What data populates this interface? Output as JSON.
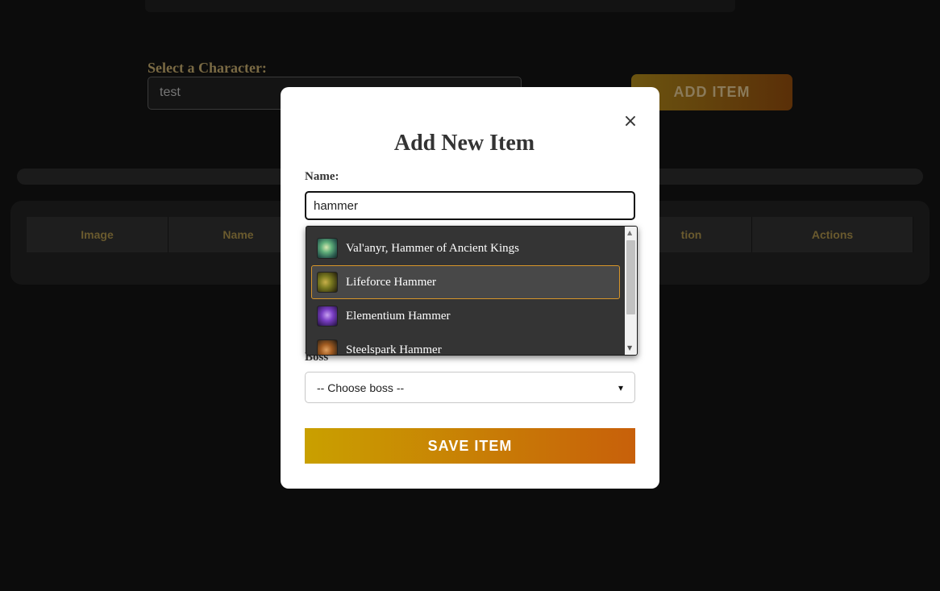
{
  "background": {
    "character_label": "Select a Character:",
    "character_value": "test",
    "add_item_label": "ADD ITEM",
    "table_headers": [
      "Image",
      "Name",
      "",
      "",
      "tion",
      "Actions"
    ]
  },
  "modal": {
    "title": "Add New Item",
    "name_label": "Name:",
    "name_value": "hammer",
    "boss_label": "Boss",
    "boss_selected": "-- Choose boss --",
    "save_label": "SAVE ITEM",
    "close_glyph": "×"
  },
  "dropdown": {
    "items": [
      {
        "label": "Val'anyr, Hammer of Ancient Kings",
        "icon": "valanyr-hammer-icon",
        "selected": false
      },
      {
        "label": "Lifeforce Hammer",
        "icon": "lifeforce-hammer-icon",
        "selected": true
      },
      {
        "label": "Elementium Hammer",
        "icon": "elementium-hammer-icon",
        "selected": false
      },
      {
        "label": "Steelspark Hammer",
        "icon": "steelspark-hammer-icon",
        "selected": false
      }
    ]
  },
  "colors": {
    "accent_start": "#c9a000",
    "accent_end": "#c8600a",
    "selected_border": "#d7952a"
  }
}
